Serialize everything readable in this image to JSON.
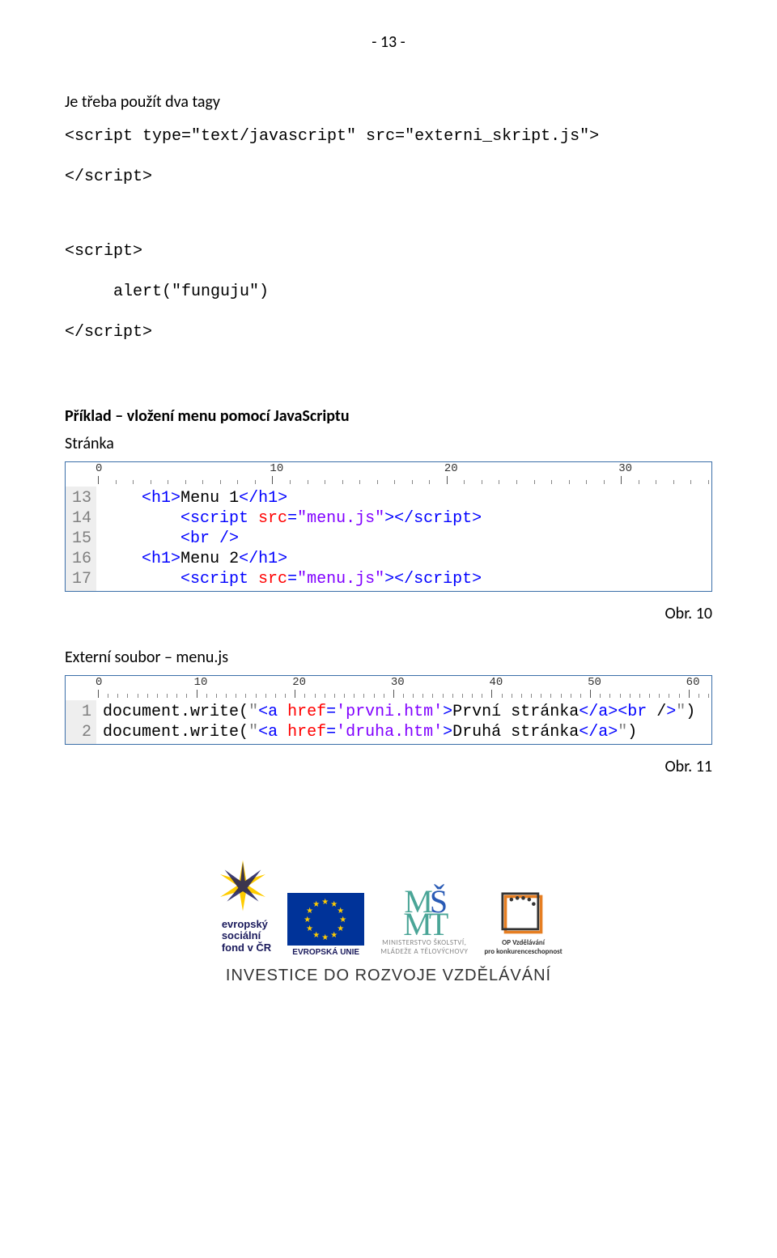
{
  "page_number": "- 13 -",
  "intro_text": "Je třeba použít dva tagy",
  "code_block_1": {
    "line1": "<script type=\"text/javascript\" src=\"externi_skript.js\">",
    "line2": "</script>"
  },
  "code_block_2": {
    "line1": "<script>",
    "line2": "alert(\"funguju\")",
    "line3": "</script>"
  },
  "section_1_title": "Příklad – vložení menu pomocí JavaScriptu",
  "section_1_sub": "Stránka",
  "fig1": {
    "ruler_labels": [
      "0",
      "10",
      "20",
      "30"
    ],
    "lines": [
      {
        "n": "13",
        "tokens": [
          {
            "indent": 1,
            "t": "<",
            "c": "tag-blue"
          },
          {
            "t": "h1",
            "c": "tag-blue"
          },
          {
            "t": ">",
            "c": "tag-blue"
          },
          {
            "t": "Menu 1",
            "c": "txt-black"
          },
          {
            "t": "</",
            "c": "tag-blue"
          },
          {
            "t": "h1",
            "c": "tag-blue"
          },
          {
            "t": ">",
            "c": "tag-blue"
          }
        ]
      },
      {
        "n": "14",
        "tokens": [
          {
            "indent": 2,
            "t": "<",
            "c": "tag-blue"
          },
          {
            "t": "script ",
            "c": "tag-blue"
          },
          {
            "t": "src",
            "c": "attr-red"
          },
          {
            "t": "=",
            "c": "tag-blue"
          },
          {
            "t": "\"menu.js\"",
            "c": "val-purple"
          },
          {
            "t": "></",
            "c": "tag-blue"
          },
          {
            "t": "script",
            "c": "tag-blue"
          },
          {
            "t": ">",
            "c": "tag-blue"
          }
        ]
      },
      {
        "n": "15",
        "tokens": [
          {
            "indent": 2,
            "t": "<",
            "c": "tag-blue"
          },
          {
            "t": "br ",
            "c": "tag-blue"
          },
          {
            "t": "/>",
            "c": "tag-blue"
          }
        ]
      },
      {
        "n": "16",
        "tokens": [
          {
            "indent": 1,
            "t": "<",
            "c": "tag-blue"
          },
          {
            "t": "h1",
            "c": "tag-blue"
          },
          {
            "t": ">",
            "c": "tag-blue"
          },
          {
            "t": "Menu 2",
            "c": "txt-black"
          },
          {
            "t": "</",
            "c": "tag-blue"
          },
          {
            "t": "h1",
            "c": "tag-blue"
          },
          {
            "t": ">",
            "c": "tag-blue"
          }
        ]
      },
      {
        "n": "17",
        "tokens": [
          {
            "indent": 2,
            "t": "<",
            "c": "tag-blue"
          },
          {
            "t": "script ",
            "c": "tag-blue"
          },
          {
            "t": "src",
            "c": "attr-red"
          },
          {
            "t": "=",
            "c": "tag-blue"
          },
          {
            "t": "\"menu.js\"",
            "c": "val-purple"
          },
          {
            "t": "></",
            "c": "tag-blue"
          },
          {
            "t": "script",
            "c": "tag-blue"
          },
          {
            "t": ">",
            "c": "tag-blue"
          }
        ]
      }
    ],
    "caption": "Obr. 10"
  },
  "section_2_title": "Externí soubor – menu.js",
  "fig2": {
    "ruler_labels": [
      "0",
      "10",
      "20",
      "30",
      "40",
      "50",
      "60"
    ],
    "lines": [
      {
        "n": "1",
        "tokens": [
          {
            "t": "document",
            "c": "func-black"
          },
          {
            "t": ".",
            "c": "txt-black"
          },
          {
            "t": "write",
            "c": "txt-black"
          },
          {
            "t": "(",
            "c": "txt-black"
          },
          {
            "t": "\"<a href='prvni.htm'>První stránka</a><br />\"",
            "c": "str-grey"
          },
          {
            "t": ")",
            "c": "txt-black"
          }
        ],
        "html_colored": true
      },
      {
        "n": "2",
        "tokens": [
          {
            "t": "document",
            "c": "func-black"
          },
          {
            "t": ".",
            "c": "txt-black"
          },
          {
            "t": "write",
            "c": "txt-black"
          },
          {
            "t": "(",
            "c": "txt-black"
          },
          {
            "t": "\"<a href='druha.htm'>Druhá stránka</a>\"",
            "c": "str-grey"
          },
          {
            "t": ")",
            "c": "txt-black"
          }
        ],
        "html_colored": true
      }
    ],
    "caption": "Obr. 11"
  },
  "footer": {
    "esf": {
      "line1": "evropský",
      "line2": "sociální",
      "line3": "fond v ČR"
    },
    "eu_label": "EVROPSKÁ UNIE",
    "msmt": {
      "line1": "MINISTERSTVO ŠKOLSTVÍ,",
      "line2": "MLÁDEŽE A TĚLOVÝCHOVY"
    },
    "opvk": {
      "line1": "OP Vzdělávání",
      "line2": "pro konkurenceschopnost"
    },
    "invest": "INVESTICE DO ROZVOJE VZDĚLÁVÁNÍ"
  }
}
